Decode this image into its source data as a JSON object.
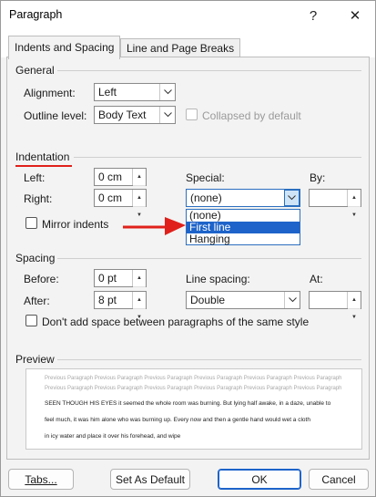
{
  "dialog": {
    "title": "Paragraph",
    "help_label": "?",
    "close_label": "✕"
  },
  "tabs": [
    {
      "label": "Indents and Spacing",
      "active": true
    },
    {
      "label": "Line and Page Breaks",
      "active": false
    }
  ],
  "general": {
    "title": "General",
    "alignment_label": "Alignment:",
    "alignment_value": "Left",
    "outline_label": "Outline level:",
    "outline_value": "Body Text",
    "collapsed_label": "Collapsed by default"
  },
  "indentation": {
    "title": "Indentation",
    "left_label": "Left:",
    "left_value": "0 cm",
    "right_label": "Right:",
    "right_value": "0 cm",
    "special_label": "Special:",
    "special_value": "(none)",
    "by_label": "By:",
    "by_value": "",
    "mirror_label": "Mirror indents",
    "special_options": [
      "(none)",
      "First line",
      "Hanging"
    ],
    "highlighted_option": "First line"
  },
  "spacing": {
    "title": "Spacing",
    "before_label": "Before:",
    "before_value": "0 pt",
    "after_label": "After:",
    "after_value": "8 pt",
    "line_spacing_label": "Line spacing:",
    "line_spacing_value": "Double",
    "at_label": "At:",
    "at_value": "",
    "dont_add_label": "Don't add space between paragraphs of the same style"
  },
  "preview": {
    "title": "Preview",
    "previous_lines": [
      "Previous Paragraph Previous Paragraph Previous Paragraph Previous Paragraph Previous Paragraph Previous Paragraph",
      "Previous Paragraph Previous Paragraph Previous Paragraph Previous Paragraph Previous Paragraph Previous Paragraph"
    ],
    "sample_lines": [
      "SEEN THOUGH HIS EYES it seemed the whole room was burning. But lying half awake, in a daze, unable to",
      "feel much, it was him alone who was burning up. Every now and then a gentle hand would wet a cloth",
      "in icy water and place it over his forehead, and wipe"
    ]
  },
  "buttons": {
    "tabs": "Tabs...",
    "set_default": "Set As Default",
    "ok": "OK",
    "cancel": "Cancel"
  },
  "colors": {
    "accent": "#1d63c9",
    "annotation_red": "#e0201a"
  }
}
